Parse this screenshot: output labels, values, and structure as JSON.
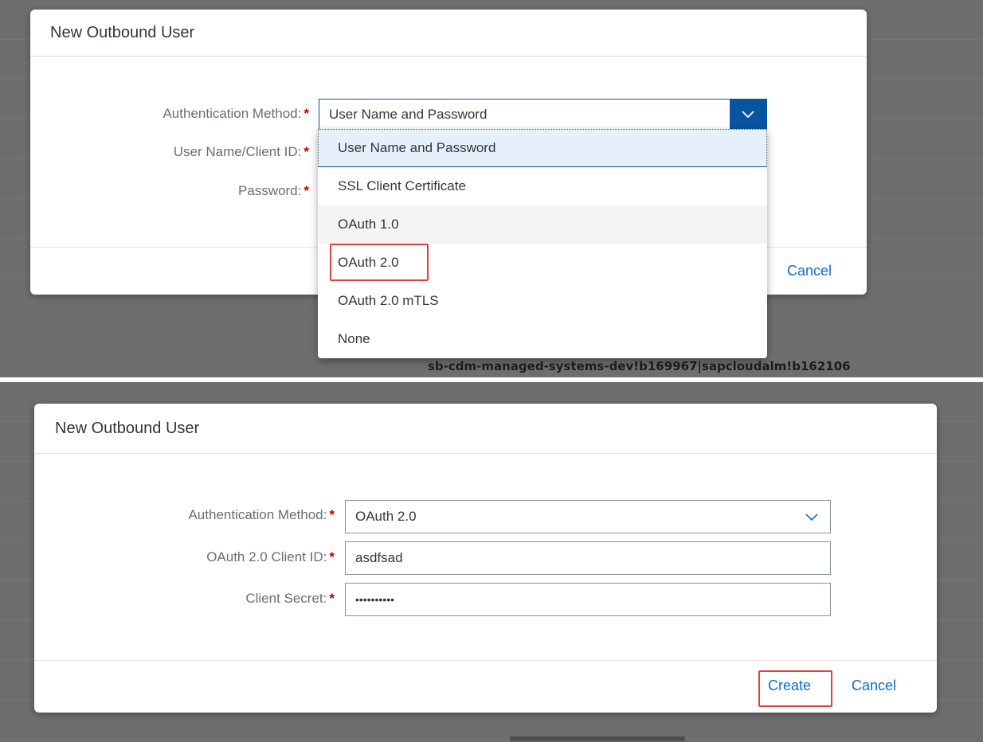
{
  "top_panel": {
    "dialog_title": "New Outbound User",
    "form": {
      "auth_method_label": "Authentication Method:",
      "auth_method_value": "User Name and Password",
      "user_label": "User Name/Client ID:",
      "password_label": "Password:"
    },
    "dropdown_options": [
      "User Name and Password",
      "SSL Client Certificate",
      "OAuth 1.0",
      "OAuth 2.0",
      "OAuth 2.0 mTLS",
      "None"
    ],
    "highlighted_option": "OAuth 2.0",
    "cancel_label": "Cancel",
    "technical_name": "sb-cdm-managed-systems-dev!b169967|sapcloudalm!b162106"
  },
  "bottom_panel": {
    "dialog_title": "New Outbound User",
    "form": {
      "auth_method_label": "Authentication Method:",
      "auth_method_value": "OAuth 2.0",
      "client_id_label": "OAuth 2.0 Client ID:",
      "client_id_value": "asdfsad",
      "client_secret_label": "Client Secret:",
      "client_secret_value": "••••••••••"
    },
    "create_label": "Create",
    "cancel_label": "Cancel"
  },
  "required_marker": "*",
  "colors": {
    "accent": "#0a6ed1",
    "dropdown_button": "#0854a0",
    "required": "#bb0000",
    "highlight_box": "#e0403f"
  }
}
